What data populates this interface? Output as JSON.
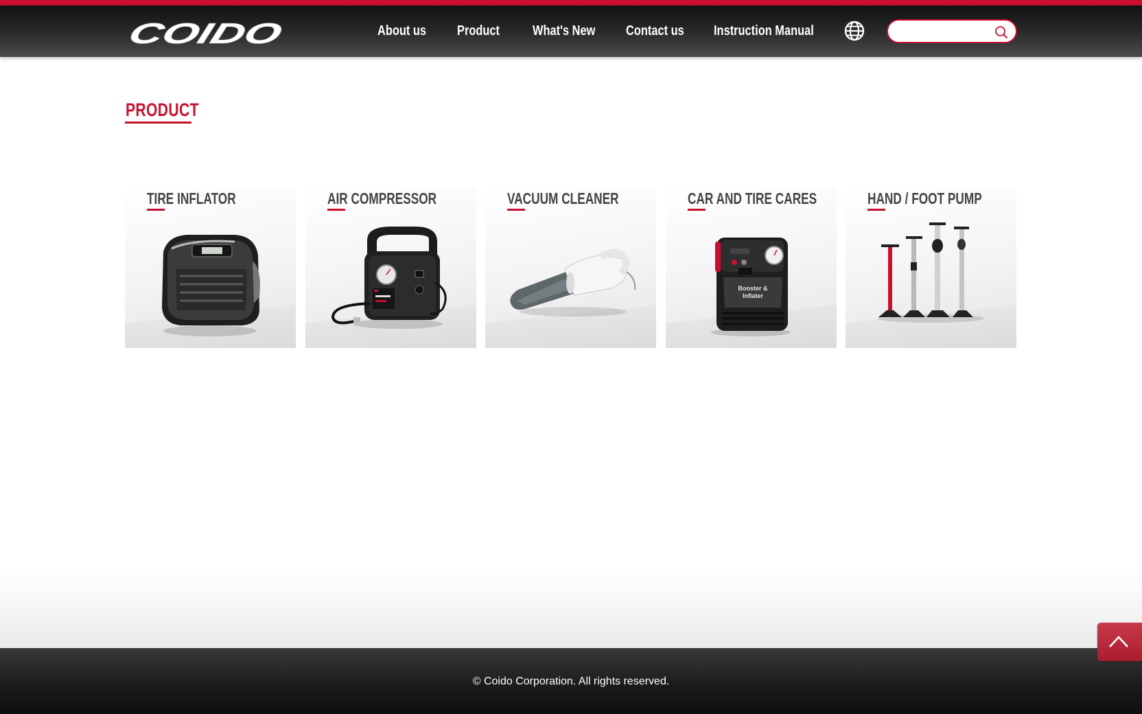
{
  "brand": {
    "logo_text": "COIDO",
    "accent_color": "#c8102e"
  },
  "nav": {
    "items": [
      "About us",
      "Product",
      "What's New",
      "Contact us",
      "Instruction Manual"
    ],
    "language_icon": "globe-icon"
  },
  "search": {
    "value": "",
    "placeholder": "",
    "icon": "search-icon"
  },
  "main": {
    "title": "PRODUCT",
    "categories": [
      {
        "label": "TIRE INFLATOR",
        "icon": "tire-inflator-image"
      },
      {
        "label": "AIR COMPRESSOR",
        "icon": "air-compressor-image"
      },
      {
        "label": "VACUUM CLEANER",
        "icon": "vacuum-cleaner-image"
      },
      {
        "label": "CAR AND TIRE CARES",
        "icon": "booster-inflater-image"
      },
      {
        "label": "HAND / FOOT PUMP",
        "icon": "foot-pump-image"
      }
    ],
    "booster_label_line1": "Booster &",
    "booster_label_line2": "Inflater"
  },
  "footer": {
    "copyright": "© Coido Corporation. All rights reserved."
  },
  "back_to_top": {
    "icon": "chevron-up-icon"
  }
}
